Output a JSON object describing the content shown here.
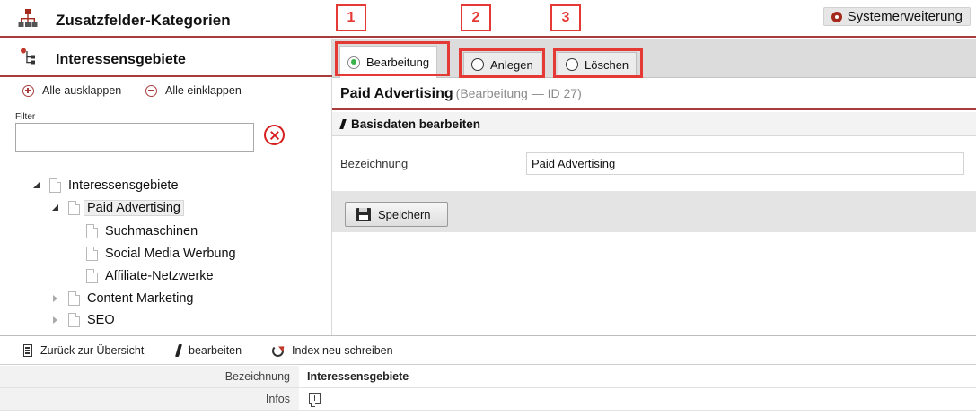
{
  "app": {
    "title": "Zusatzfelder-Kategorien",
    "extension_button": "Systemerweiterung"
  },
  "left_panel": {
    "title": "Interessensgebiete",
    "expand_all": "Alle ausklappen",
    "collapse_all": "Alle einklappen",
    "filter_label": "Filter",
    "filter_value": "",
    "tree": [
      {
        "label": "Interessensgebiete",
        "state": "expanded",
        "level": 0
      },
      {
        "label": "Paid Advertising",
        "state": "expanded",
        "level": 1,
        "selected": true
      },
      {
        "label": "Suchmaschinen",
        "state": "leaf",
        "level": 2
      },
      {
        "label": "Social Media Werbung",
        "state": "leaf",
        "level": 2
      },
      {
        "label": "Affiliate-Netzwerke",
        "state": "leaf",
        "level": 2
      },
      {
        "label": "Content Marketing",
        "state": "collapsed",
        "level": 1
      },
      {
        "label": "SEO",
        "state": "collapsed",
        "level": 1
      }
    ]
  },
  "tabs": [
    {
      "label": "Bearbeitung",
      "active": true,
      "callout": "1"
    },
    {
      "label": "Anlegen",
      "active": false,
      "callout": "2"
    },
    {
      "label": "Löschen",
      "active": false,
      "callout": "3"
    }
  ],
  "content": {
    "title": "Paid Advertising",
    "subtitle": "(Bearbeitung — ID 27)",
    "section": "Basisdaten bearbeiten",
    "field_label": "Bezeichnung",
    "field_value": "Paid Advertising",
    "save_button": "Speichern"
  },
  "bottom": {
    "actions": {
      "back": "Zurück zur Übersicht",
      "edit": "bearbeiten",
      "reindex": "Index neu schreiben"
    },
    "info": {
      "name_key": "Bezeichnung",
      "name_value": "Interessensgebiete",
      "infos_key": "Infos"
    }
  },
  "colors": {
    "accent_rule": "#a83c3c",
    "callout": "#e53935",
    "active_radio": "#3ab34a"
  }
}
